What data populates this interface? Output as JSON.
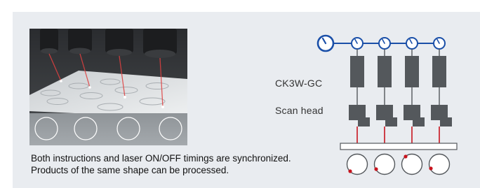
{
  "diagram": {
    "controller_label": "CK3W-GC",
    "scan_head_label": "Scan head",
    "channel_count": 4
  },
  "caption": {
    "line1": "Both instructions and laser ON/OFF timings are synchronized.",
    "line2": "Products of the same shape can be processed."
  },
  "colors": {
    "accent_blue": "#1a4fa8",
    "laser_red": "#c8141e",
    "unit_gray": "#54585c",
    "panel_bg": "#e9ecf0"
  }
}
